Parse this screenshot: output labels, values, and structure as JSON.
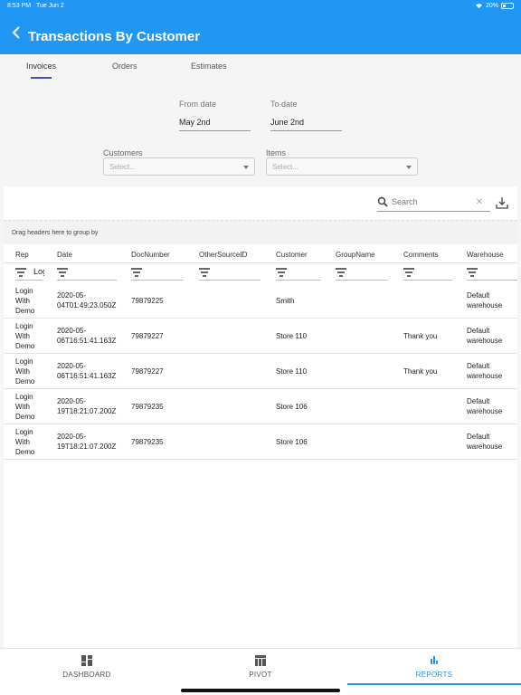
{
  "status": {
    "time": "8:53 PM",
    "date": "Tue Jun 2",
    "battery": "20%"
  },
  "appbar": {
    "title": "Transactions By Customer"
  },
  "tabs": [
    {
      "label": "Invoices",
      "active": true
    },
    {
      "label": "Orders",
      "active": false
    },
    {
      "label": "Estimates",
      "active": false
    }
  ],
  "filters": {
    "from_label": "From date",
    "from_value": "May 2nd",
    "to_label": "To date",
    "to_value": "June 2nd",
    "customers_label": "Customers",
    "customers_placeholder": "Select...",
    "items_label": "Items",
    "items_placeholder": "Select..."
  },
  "grid": {
    "search_placeholder": "Search",
    "group_hint": "Drag headers here to group by",
    "columns": [
      "Rep",
      "Date",
      "DocNumber",
      "OtherSourceID",
      "Customer",
      "GroupName",
      "Comments",
      "Warehouse"
    ],
    "rep_filter_value": "Log",
    "rows": [
      {
        "rep": "Login With Demo",
        "date": "2020-05-04T01:49:23.050Z",
        "doc": "79879225",
        "other": "",
        "customer": "Smith",
        "group": "",
        "comments": "",
        "warehouse": "Default warehouse"
      },
      {
        "rep": "Login With Demo",
        "date": "2020-05-06T16:51:41.163Z",
        "doc": "79879227",
        "other": "",
        "customer": "Store 110",
        "group": "",
        "comments": "Thank you",
        "warehouse": "Default warehouse"
      },
      {
        "rep": "Login With Demo",
        "date": "2020-05-06T16:51:41.163Z",
        "doc": "79879227",
        "other": "",
        "customer": "Store 110",
        "group": "",
        "comments": "Thank you",
        "warehouse": "Default warehouse"
      },
      {
        "rep": "Login With Demo",
        "date": "2020-05-19T18:21:07.200Z",
        "doc": "79879235",
        "other": "",
        "customer": "Store 106",
        "group": "",
        "comments": "",
        "warehouse": "Default warehouse"
      },
      {
        "rep": "Login With Demo",
        "date": "2020-05-19T18:21:07.200Z",
        "doc": "79879235",
        "other": "",
        "customer": "Store 106",
        "group": "",
        "comments": "",
        "warehouse": "Default warehouse"
      }
    ]
  },
  "bottomnav": [
    {
      "label": "DASHBOARD",
      "icon": "dashboard-icon",
      "active": false
    },
    {
      "label": "PIVOT",
      "icon": "pivot-table-icon",
      "active": false
    },
    {
      "label": "REPORTS",
      "icon": "bar-chart-icon",
      "active": true
    }
  ],
  "colors": {
    "primary": "#2196f3",
    "tab_indicator": "#3f51b5"
  }
}
